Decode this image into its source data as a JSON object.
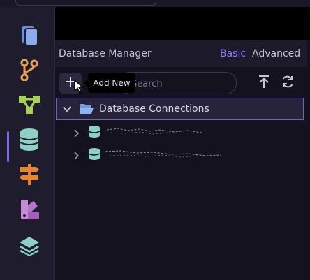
{
  "activity_bar": {
    "items": [
      {
        "icon": "files-icon"
      },
      {
        "icon": "git-branch-icon"
      },
      {
        "icon": "graph-icon"
      },
      {
        "icon": "database-icon",
        "active": true
      },
      {
        "icon": "signpost-icon"
      },
      {
        "icon": "palette-icon"
      },
      {
        "icon": "layers-icon"
      }
    ]
  },
  "panel": {
    "title": "Database Manager",
    "tabs": {
      "basic": "Basic",
      "advanced": "Advanced"
    },
    "active_tab": "Basic"
  },
  "toolbar": {
    "add_tooltip": "Add New",
    "search_placeholder": "Search"
  },
  "tree": {
    "root_label": "Database Connections",
    "items": [
      {
        "label": ""
      },
      {
        "label": ""
      }
    ]
  },
  "colors": {
    "accent": "#7d63ff",
    "selection_border": "#6f5fd0",
    "db_icon": "#8fd0c4"
  }
}
